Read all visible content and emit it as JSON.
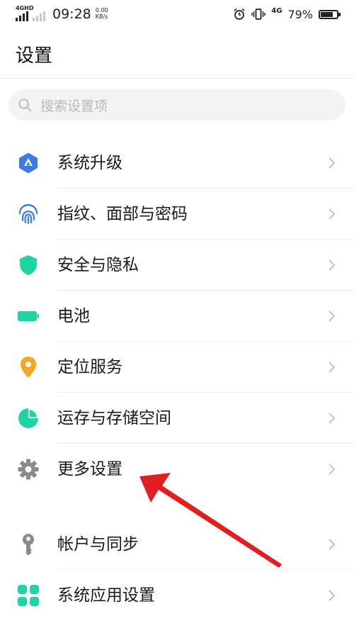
{
  "status_bar": {
    "network": "4GHD",
    "time": "09:28",
    "speed_value": "0.00",
    "speed_unit": "KB/s",
    "network_right": "4G",
    "battery_percent": "79%",
    "battery_level": 0.79
  },
  "page_title": "设置",
  "search": {
    "placeholder": "搜索设置项"
  },
  "settings": [
    {
      "label": "系统升级",
      "icon": "system-update-icon",
      "color": "#3a7be6"
    },
    {
      "label": "指纹、面部与密码",
      "icon": "fingerprint-icon",
      "color": "#3a7be6"
    },
    {
      "label": "安全与隐私",
      "icon": "shield-icon",
      "color": "#1ed4a0"
    },
    {
      "label": "电池",
      "icon": "battery-icon",
      "color": "#1ed4a0"
    },
    {
      "label": "定位服务",
      "icon": "location-pin-icon",
      "color": "#f5a623"
    },
    {
      "label": "运存与存储空间",
      "icon": "storage-pie-icon",
      "color": "#1ed4a0"
    },
    {
      "label": "更多设置",
      "icon": "gear-icon",
      "color": "#8a8a8a"
    },
    {
      "label": "帐户与同步",
      "icon": "key-icon",
      "color": "#8a8a8a"
    },
    {
      "label": "系统应用设置",
      "icon": "apps-icon",
      "color": "#1ed4a0"
    }
  ],
  "annotation": {
    "type": "red-arrow",
    "points_to": "更多设置",
    "color": "#e02020"
  }
}
